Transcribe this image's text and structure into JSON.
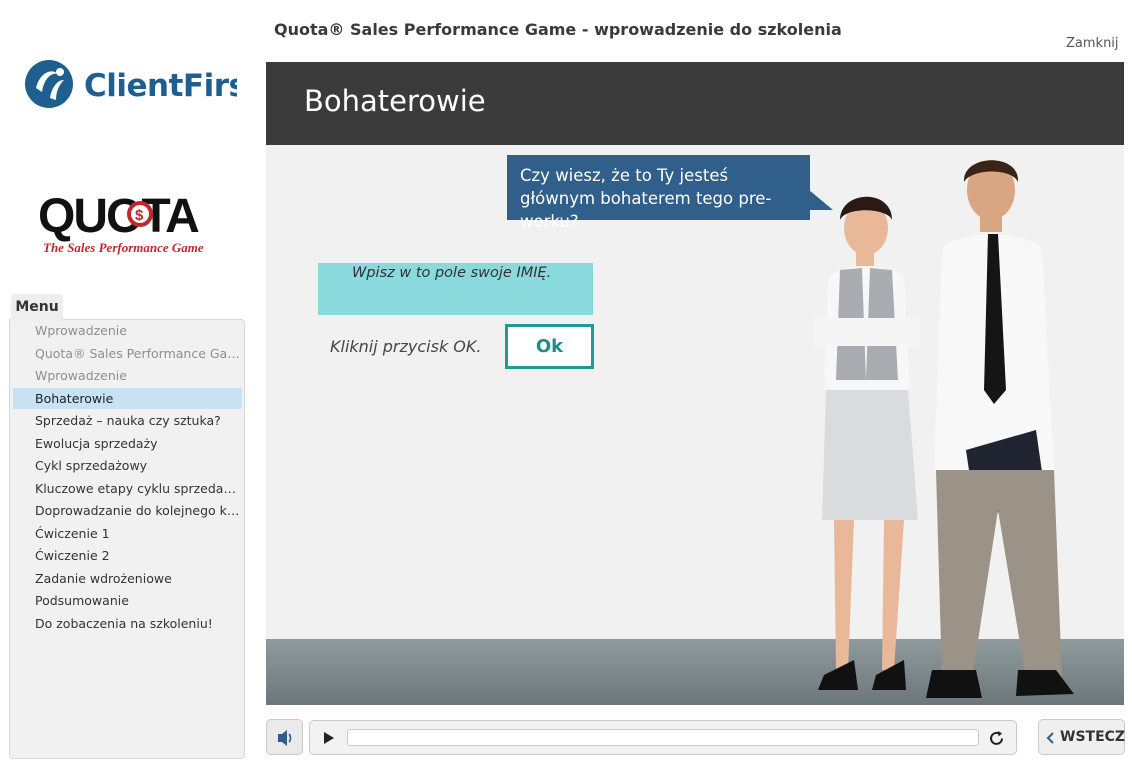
{
  "header": {
    "course_title": "Quota® Sales Performance Game - wprowadzenie do szkolenia",
    "close_label": "Zamknij"
  },
  "logos": {
    "clientfirst_text": "ClientFirst",
    "quota_text": "QUOTA",
    "quota_tagline": "The Sales Performance Game"
  },
  "menu": {
    "tab_label": "Menu",
    "items": [
      {
        "label": "Wprowadzenie",
        "state": "visited"
      },
      {
        "label": "Quota® Sales Performance Game",
        "state": "visited"
      },
      {
        "label": "Wprowadzenie",
        "state": "visited"
      },
      {
        "label": "Bohaterowie",
        "state": "active"
      },
      {
        "label": "Sprzedaż – nauka czy sztuka?",
        "state": "normal"
      },
      {
        "label": "Ewolucja sprzedaży",
        "state": "normal"
      },
      {
        "label": "Cykl sprzedażowy",
        "state": "normal"
      },
      {
        "label": "Kluczowe etapy cyklu sprzedażow...",
        "state": "normal"
      },
      {
        "label": "Doprowadzanie do kolejnego kluc...",
        "state": "normal"
      },
      {
        "label": "Ćwiczenie 1",
        "state": "normal"
      },
      {
        "label": "Ćwiczenie 2",
        "state": "normal"
      },
      {
        "label": "Zadanie wdrożeniowe",
        "state": "normal"
      },
      {
        "label": "Podsumowanie",
        "state": "normal"
      },
      {
        "label": "Do zobaczenia  na szkoleniu!",
        "state": "normal"
      }
    ]
  },
  "slide": {
    "title": "Bohaterowie",
    "bubble_text": "Czy wiesz, że to Ty jesteś głównym bohaterem tego pre-worku?",
    "name_field_placeholder": "Wpisz w to pole swoje IMIĘ.",
    "name_field_value": "",
    "click_hint": "Kliknij przycisk OK.",
    "ok_label": "Ok"
  },
  "player": {
    "back_label": "WSTECZ",
    "progress": 0
  },
  "colors": {
    "header_bg": "#3b3b3b",
    "bubble_bg": "#2f5f8a",
    "field_bg": "#8ad9dd",
    "ok_border": "#1f9a95",
    "menu_active": "#c7e2f3",
    "brand_blue": "#1f5f8f",
    "quota_red": "#c0282d"
  }
}
